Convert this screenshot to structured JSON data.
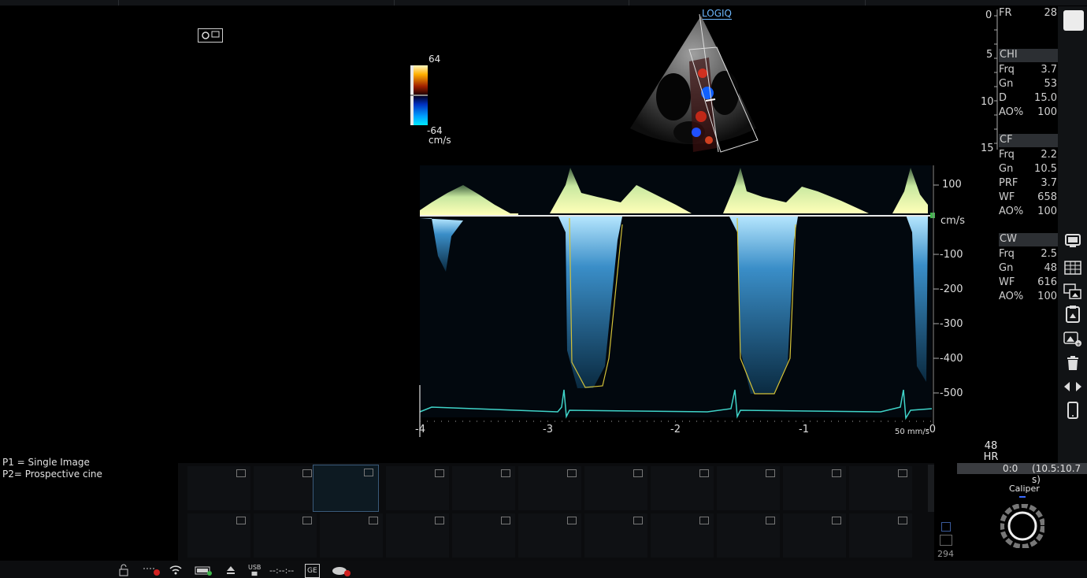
{
  "image": {
    "logo_label": "LOGIQ",
    "colorbar": {
      "max": "64",
      "min": "-64",
      "unit": "cm/s"
    }
  },
  "doppler": {
    "y_ticks": [
      "100",
      "cm/s",
      "-100",
      "-200",
      "-300",
      "-400",
      "-500"
    ],
    "x_ticks": [
      "-4",
      "-3",
      "-2",
      "-1",
      "-0"
    ],
    "sweep_speed": "50 mm/s"
  },
  "depth_scale": [
    "0",
    "5",
    "10",
    "15"
  ],
  "params": {
    "fr": {
      "label": "FR",
      "value": "28"
    },
    "chi": {
      "title": "CHI",
      "rows": [
        {
          "k": "Frq",
          "v": "3.7"
        },
        {
          "k": "Gn",
          "v": "53"
        },
        {
          "k": "D",
          "v": "15.0"
        },
        {
          "k": "AO%",
          "v": "100"
        }
      ]
    },
    "cf": {
      "title": "CF",
      "rows": [
        {
          "k": "Frq",
          "v": "2.2"
        },
        {
          "k": "Gn",
          "v": "10.5"
        },
        {
          "k": "PRF",
          "v": "3.7"
        },
        {
          "k": "WF",
          "v": "658"
        },
        {
          "k": "AO%",
          "v": "100"
        }
      ]
    },
    "cw": {
      "title": "CW",
      "rows": [
        {
          "k": "Frq",
          "v": "2.5"
        },
        {
          "k": "Gn",
          "v": "48"
        },
        {
          "k": "WF",
          "v": "616"
        },
        {
          "k": "AO%",
          "v": "100"
        }
      ]
    }
  },
  "hr": {
    "value": "48",
    "label": "HR"
  },
  "info": {
    "p1": "P1 = Single Image",
    "p2": "P2= Prospective cine"
  },
  "cine": {
    "position": "0:0",
    "range": "(10.5:10.7 s)",
    "count": "294"
  },
  "caliper_label": "Caliper",
  "status": {
    "usb_label": "USB",
    "clock": "--:--:--",
    "ge_label": "GE"
  },
  "tools": [
    "monitor-icon",
    "grid-icon",
    "image-compare-icon",
    "clipboard-icon",
    "add-image-icon",
    "trash-icon",
    "prev-next-icon",
    "mobile-icon"
  ]
}
